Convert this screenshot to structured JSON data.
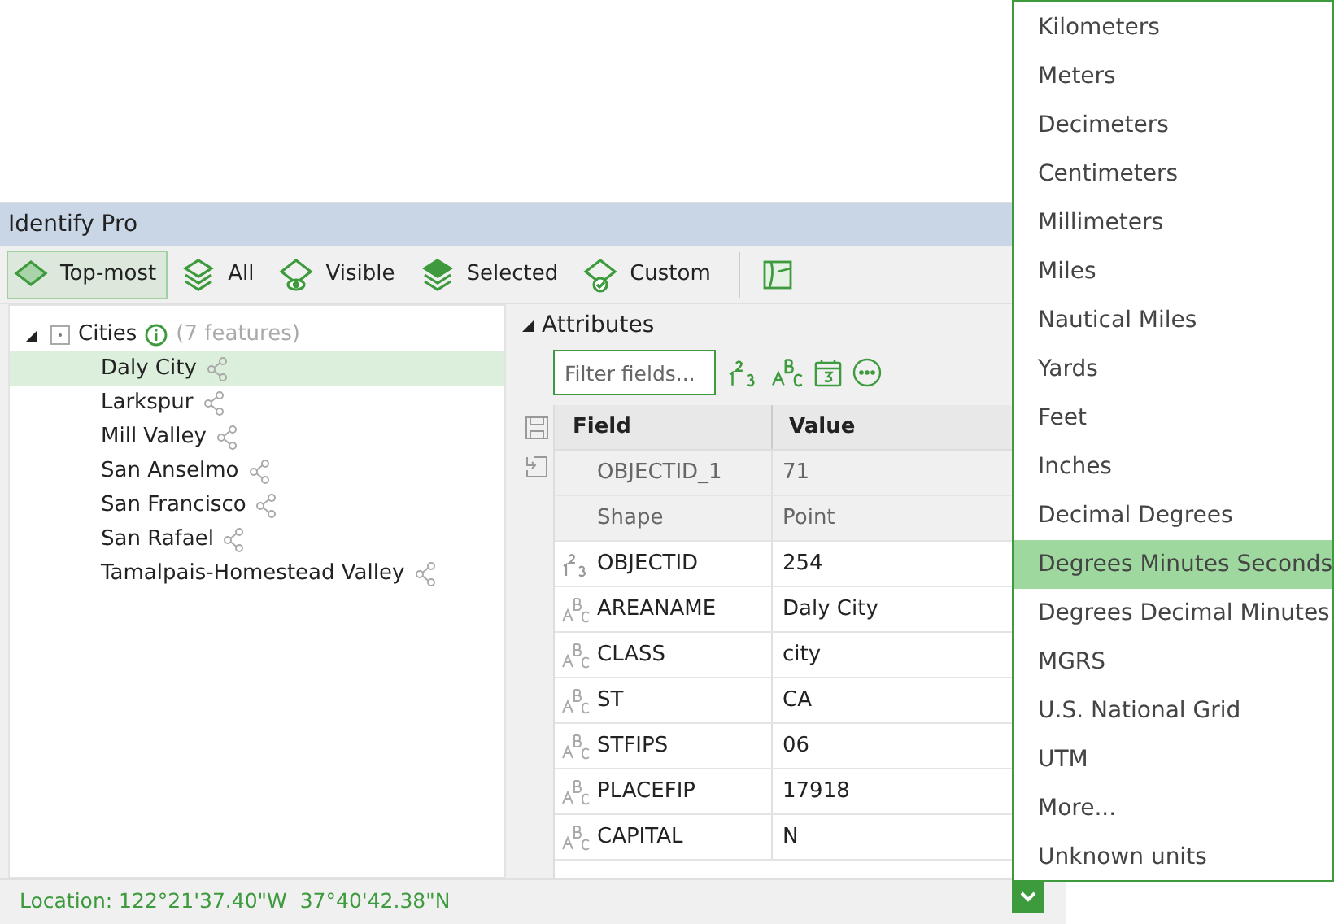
{
  "window": {
    "title": "Identify Pro"
  },
  "toolbar": {
    "buttons": [
      {
        "label": "Top-most",
        "kind": "topmost",
        "selected": true
      },
      {
        "label": "All",
        "kind": "all",
        "selected": false
      },
      {
        "label": "Visible",
        "kind": "visible",
        "selected": false
      },
      {
        "label": "Selected",
        "kind": "selected",
        "selected": false
      },
      {
        "label": "Custom",
        "kind": "custom",
        "selected": false
      }
    ]
  },
  "tree": {
    "layer": {
      "name": "Cities",
      "count": "(7 features)",
      "expanded": true,
      "children": [
        {
          "name": "Daly City",
          "selected": true
        },
        {
          "name": "Larkspur",
          "selected": false
        },
        {
          "name": "Mill Valley",
          "selected": false
        },
        {
          "name": "San Anselmo",
          "selected": false
        },
        {
          "name": "San Francisco",
          "selected": false
        },
        {
          "name": "San Rafael",
          "selected": false
        },
        {
          "name": "Tamalpais-Homestead Valley",
          "selected": false
        }
      ]
    }
  },
  "attributes": {
    "title": "Attributes",
    "expanded": true,
    "filter": {
      "placeholder": "Filter fields..."
    },
    "columns": [
      "Field",
      "Value"
    ],
    "rows": [
      {
        "kind": "system",
        "field": "OBJECTID_1",
        "value": "71"
      },
      {
        "kind": "system",
        "field": "Shape",
        "value": "Point"
      },
      {
        "kind": "number",
        "field": "OBJECTID",
        "value": "254"
      },
      {
        "kind": "text",
        "field": "AREANAME",
        "value": "Daly City"
      },
      {
        "kind": "text",
        "field": "CLASS",
        "value": "city"
      },
      {
        "kind": "text",
        "field": "ST",
        "value": "CA"
      },
      {
        "kind": "text",
        "field": "STFIPS",
        "value": "06"
      },
      {
        "kind": "text",
        "field": "PLACEFIP",
        "value": "17918"
      },
      {
        "kind": "text",
        "field": "CAPITAL",
        "value": "N"
      }
    ]
  },
  "status_bar": {
    "location": "Location: 122°21'37.40\"W  37°40'42.38\"N"
  },
  "units_menu": {
    "items": [
      {
        "label": "Kilometers",
        "selected": false
      },
      {
        "label": "Meters",
        "selected": false
      },
      {
        "label": "Decimeters",
        "selected": false
      },
      {
        "label": "Centimeters",
        "selected": false
      },
      {
        "label": "Millimeters",
        "selected": false
      },
      {
        "label": "Miles",
        "selected": false
      },
      {
        "label": "Nautical Miles",
        "selected": false
      },
      {
        "label": "Yards",
        "selected": false
      },
      {
        "label": "Feet",
        "selected": false
      },
      {
        "label": "Inches",
        "selected": false
      },
      {
        "label": "Decimal Degrees",
        "selected": false
      },
      {
        "label": "Degrees Minutes Seconds",
        "selected": true
      },
      {
        "label": "Degrees Decimal Minutes",
        "selected": false
      },
      {
        "label": "MGRS",
        "selected": false
      },
      {
        "label": "U.S. National Grid",
        "selected": false
      },
      {
        "label": "UTM",
        "selected": false
      },
      {
        "label": "More...",
        "selected": false
      },
      {
        "label": "Unknown units",
        "selected": false
      }
    ]
  }
}
